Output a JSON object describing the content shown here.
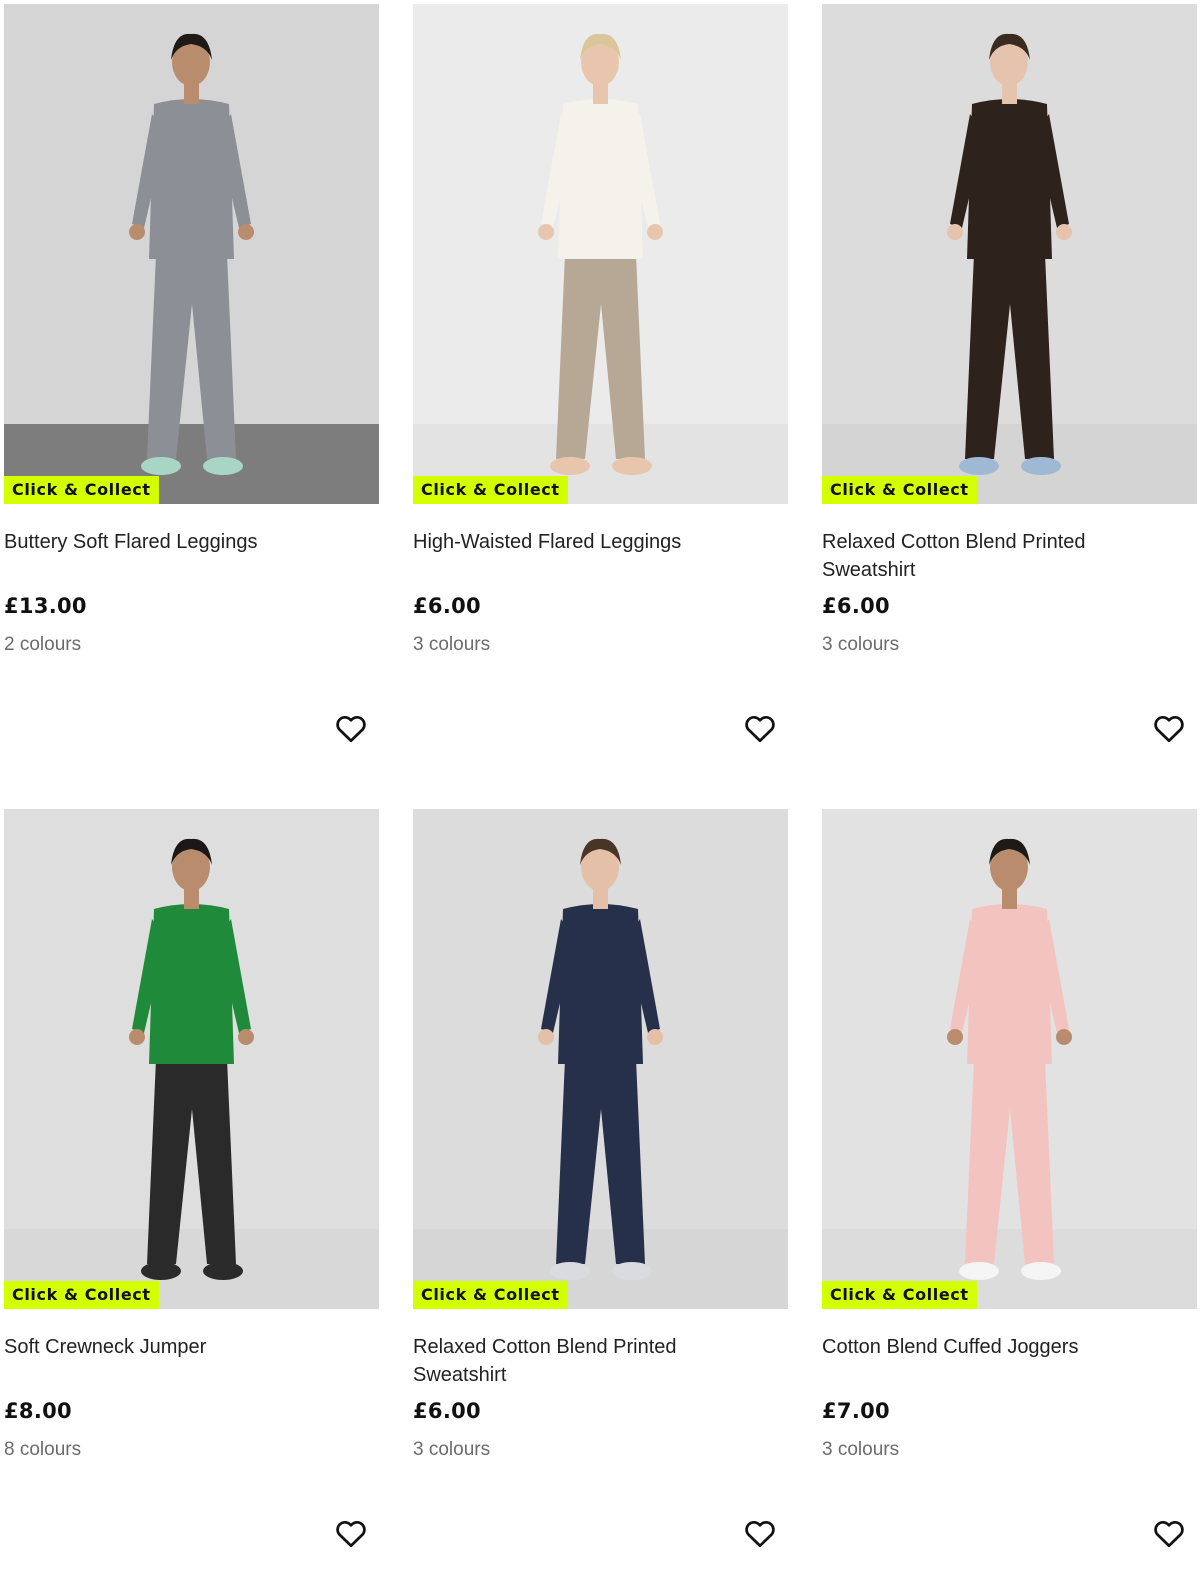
{
  "products": [
    {
      "badge": "Click & Collect",
      "title": "Buttery Soft Flared Leggings",
      "price": "£13.00",
      "colours": "2 colours",
      "colors": {
        "bg": "#d5d5d5",
        "floor": "#7d7d7d",
        "top": "#8c9096",
        "bottom": "#8c9096",
        "skin": "#b98c6e",
        "hair": "#1d1a18",
        "shoes": "#a9d6c4"
      }
    },
    {
      "badge": "Click & Collect",
      "title": "High-Waisted Flared Leggings",
      "price": "£6.00",
      "colours": "3 colours",
      "colors": {
        "bg": "#ebebeb",
        "floor": "#e3e3e3",
        "top": "#f4f2ea",
        "bottom": "#b7a896",
        "skin": "#e8c6ae",
        "hair": "#d9c69a",
        "shoes": "#e8c6ae"
      }
    },
    {
      "badge": "Click & Collect",
      "title": "Relaxed Cotton Blend Printed Sweatshirt",
      "price": "£6.00",
      "colours": "3 colours",
      "colors": {
        "bg": "#dcdcdc",
        "floor": "#d4d4d4",
        "top": "#2e221d",
        "bottom": "#2e221d",
        "skin": "#e6c3ad",
        "hair": "#3a2a22",
        "shoes": "#9fb8d4"
      }
    },
    {
      "badge": "Click & Collect",
      "title": "Soft Crewneck Jumper",
      "price": "£8.00",
      "colours": "8 colours",
      "colors": {
        "bg": "#dedede",
        "floor": "#d8d8d8",
        "top": "#1e8a3a",
        "bottom": "#2a2a2a",
        "skin": "#b98c6e",
        "hair": "#1a1716",
        "shoes": "#2a2a2a"
      }
    },
    {
      "badge": "Click & Collect",
      "title": "Relaxed Cotton Blend Printed Sweatshirt",
      "price": "£6.00",
      "colours": "3 colours",
      "colors": {
        "bg": "#dcdcdc",
        "floor": "#d6d6d6",
        "top": "#26304a",
        "bottom": "#26304a",
        "skin": "#e4c0a8",
        "hair": "#4a3426",
        "shoes": "#d9dbde"
      }
    },
    {
      "badge": "Click & Collect",
      "title": "Cotton Blend Cuffed Joggers",
      "price": "£7.00",
      "colours": "3 colours",
      "colors": {
        "bg": "#e2e2e2",
        "floor": "#dcdcdc",
        "top": "#f3c4bf",
        "bottom": "#f3c4bf",
        "skin": "#b98c6e",
        "hair": "#1d1a18",
        "shoes": "#f5f5f5"
      }
    }
  ],
  "icons": {
    "favourite": "heart-outline-icon"
  }
}
